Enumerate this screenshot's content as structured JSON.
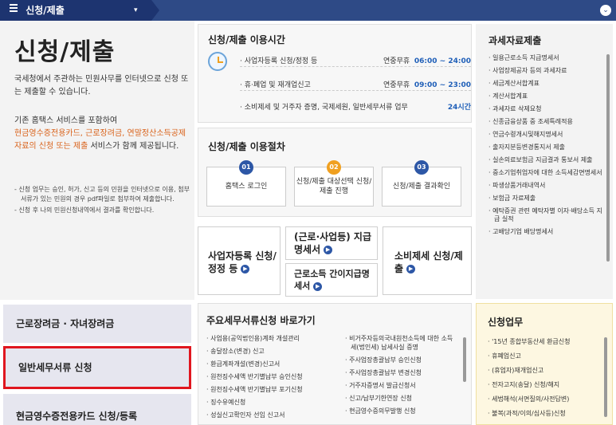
{
  "topbar": {
    "breadcrumb": "신청/제출",
    "caret": "▾",
    "expand_icon": "⌄"
  },
  "intro": {
    "title": "신청/제출",
    "para1": "국세청에서 주관하는 민원사무를 인터넷으로 신청 또는 제출할 수 있습니다.",
    "para2_prefix": "기존 홈택스 서비스를 포함하여",
    "para2_highlight": "현금영수증전용카드, 근로장려금, 연말정산소득공제자료의 신청 또는 제출",
    "para2_suffix": "서비스가 함께 제공됩니다.",
    "notes": [
      "- 신청 업무는 승인, 허가, 신고 등의 민원을 인터넷으로 이용, 첨부서류가 있는 민원의 경우 pdf파일로 첨부하여 제출합니다.",
      "- 신청 후 나의 민원신청내역에서 결과를 확인합니다."
    ]
  },
  "left_menu": [
    {
      "label": "근로장려금 · 자녀장려금"
    },
    {
      "label": "일반세무서류 신청"
    },
    {
      "label": "현금영수증전용카드 신청/등록"
    }
  ],
  "hours": {
    "title": "신청/제출 이용시간",
    "rows": [
      {
        "label": "· 사업자등록 신청/정정 등",
        "prefix": "연중무휴",
        "time": "06:00 ~ 24:00"
      },
      {
        "label": "· 휴·폐업 및 재개업신고",
        "prefix": "연중무휴",
        "time": "09:00 ~ 23:00"
      },
      {
        "label": "· 소비제세 및 거주자 증명, 국제세원, 일반세무서류 업무",
        "prefix": "",
        "time": "24시간"
      }
    ]
  },
  "procedure": {
    "title": "신청/제출 이용절차",
    "steps": [
      {
        "num": "01",
        "label": "홈택스 로그인"
      },
      {
        "num": "02",
        "label": "신청/제출 대상선택 신청/제출 진행"
      },
      {
        "num": "03",
        "label": "신청/제출 결과확인"
      }
    ]
  },
  "quick": {
    "biz_reg": "사업자등록 신청/정정 등",
    "payment_statement": "(근로·사업등) 지급명세서",
    "simple_statement": "근로소득 간이지급명세서",
    "consumption_tax": "소비제세 신청/제출"
  },
  "docs": {
    "title": "주요세무서류신청 바로가기",
    "col1": [
      "사업용(공익법인용)계좌 개설관리",
      "송달장소(변경) 신고",
      "환급계좌개설(변경)신고서",
      "원천징수세액 반기별납부 승인신청",
      "원천징수세액 반기별납부 포기신청",
      "징수유예신청",
      "성실신고확인자 선임 신고서"
    ],
    "col2": [
      "비거주자등의국내원천소득에 대한 소득세(법인세) 납세사실 증명",
      "주사업장총괄납부 승인신청",
      "주사업장총괄납부 변경신청",
      "거주자증명서 발급신청서",
      "신고/납부기한연장 신청",
      "현금영수증의무발행 신청"
    ]
  },
  "tax_data": {
    "title": "과세자료제출",
    "items": [
      "일용근로소득 지급명세서",
      "사업장제공자 등의 과세자료",
      "세금계산서합계표",
      "계산서합계표",
      "과세자료 삭제요청",
      "신종금융상품 중 조세특례적용",
      "연금수령개시및해지명세서",
      "출자지분등변경통지서 제출",
      "실손의료보험금 지급결과 통보서 제출",
      "중소기업취업자에 대한 소득세감면명세서",
      "파생상품거래내역서",
      "보험금 자료제출",
      "예탁증권 관련 예탁자별 이자·배당소득 지급 실적",
      "고배당기업 배당명세서"
    ]
  },
  "business": {
    "title": "신청업무",
    "items": [
      "'15년 종합부동산세 환급신청",
      "휴폐업신고",
      "(휴업자)재개업신고",
      "전자고지(송달) 신청/해지",
      "세법해석(서면질의/사전답변)",
      "불복(과적/이의/심사등)신청"
    ]
  },
  "colors": {
    "topbar": "#2e4a86",
    "accent_orange": "#d9621a",
    "time_blue": "#1f5fb8",
    "highlight_red": "#e0161f"
  }
}
